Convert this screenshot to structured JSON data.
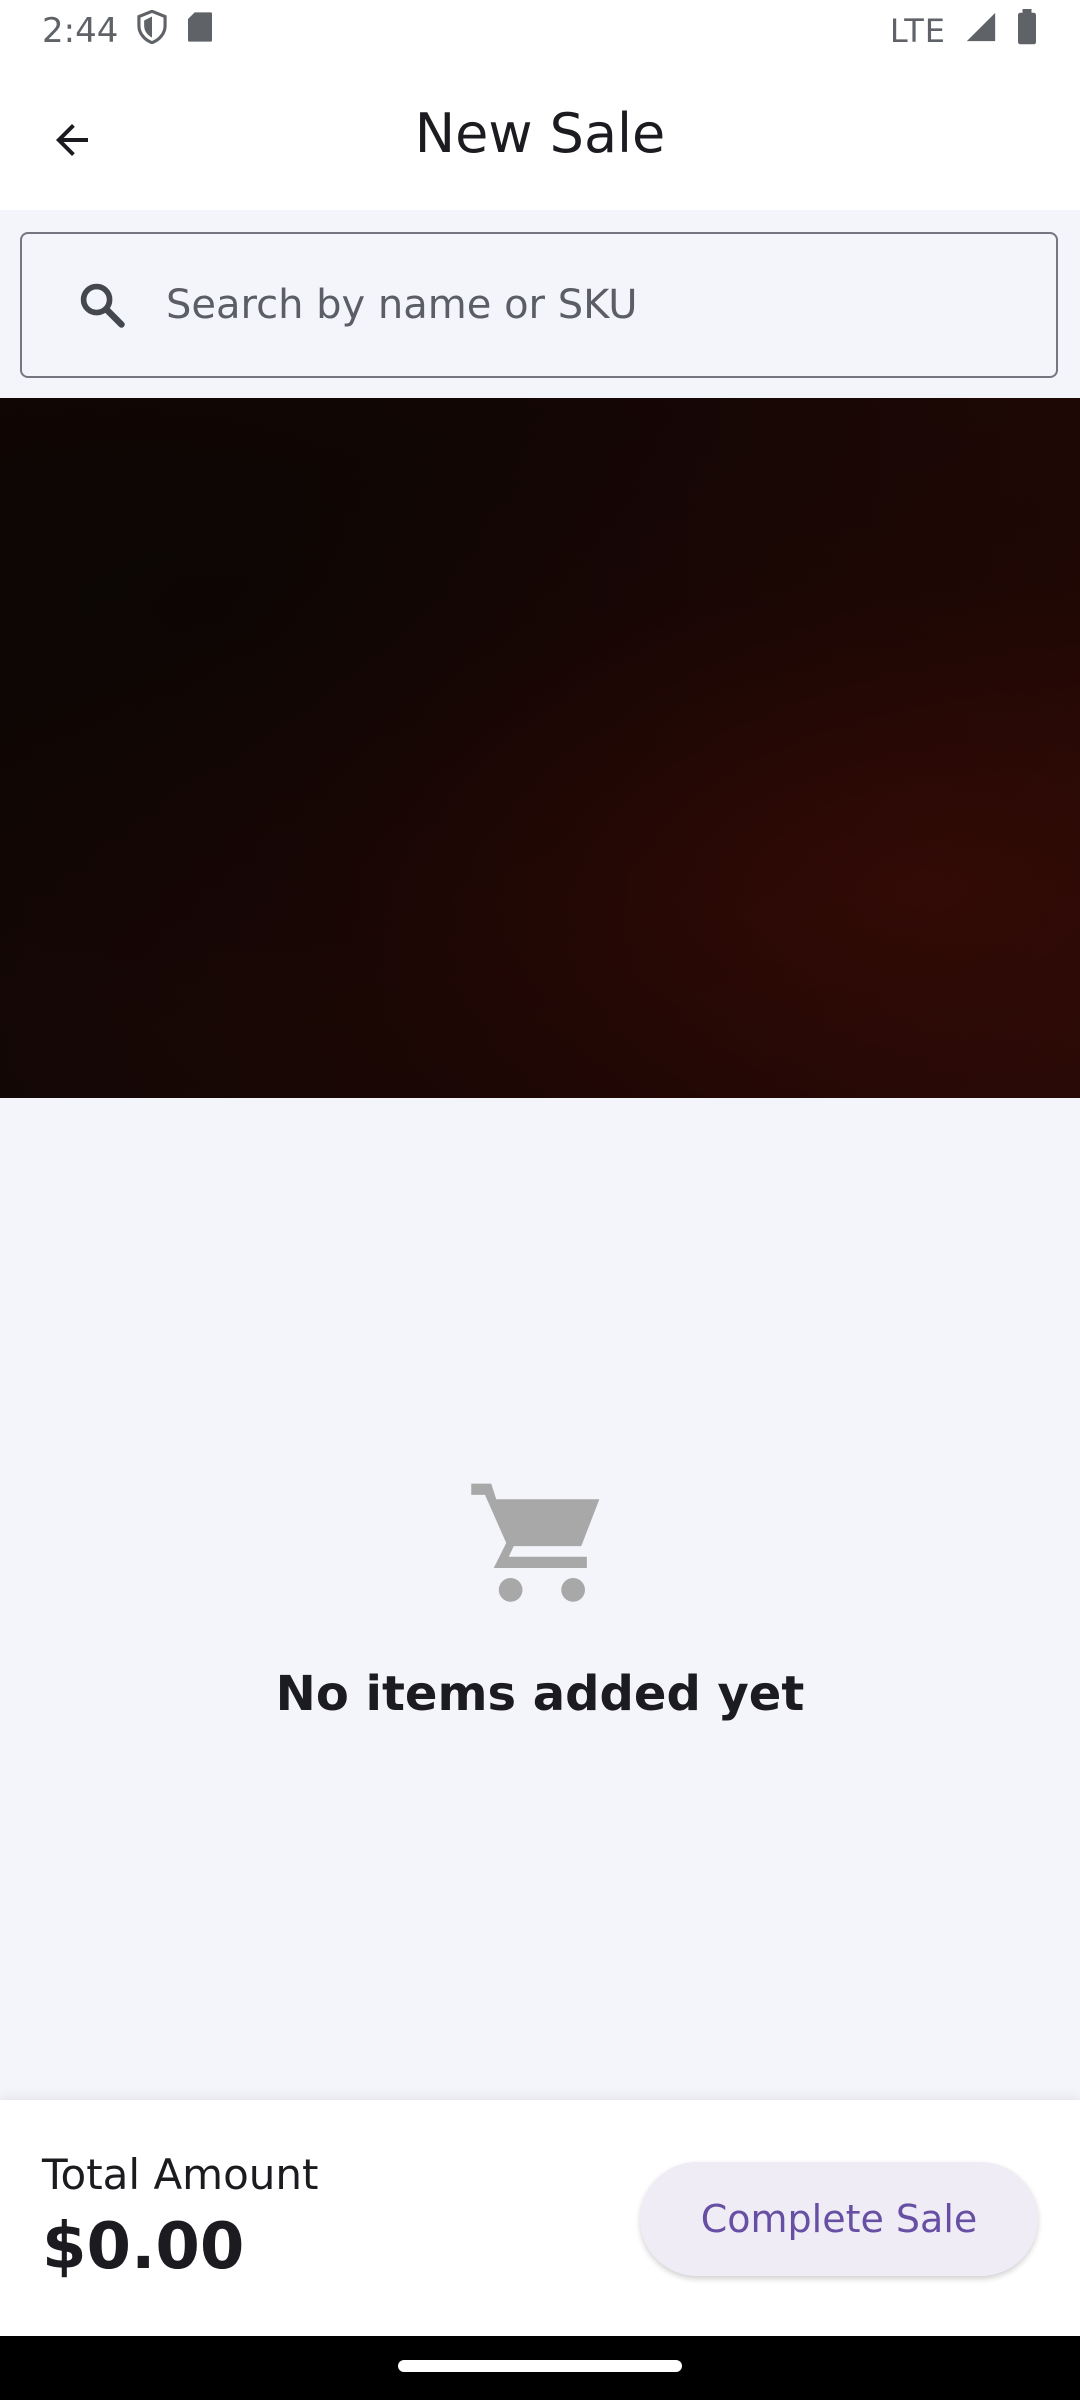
{
  "status_bar": {
    "time": "2:44",
    "network": "LTE",
    "icons": [
      "shield-icon",
      "sd-card-icon",
      "signal-icon",
      "battery-icon"
    ]
  },
  "app_bar": {
    "title": "New Sale",
    "back_icon": "arrow-back-icon"
  },
  "search": {
    "placeholder": "Search by name or SKU",
    "value": "",
    "icon": "search-icon"
  },
  "camera_preview": {
    "state": "dark"
  },
  "empty_state": {
    "icon": "shopping-cart-icon",
    "message": "No items added yet"
  },
  "footer": {
    "total_label": "Total Amount",
    "total_value": "$0.00",
    "complete_button_label": "Complete Sale"
  },
  "colors": {
    "accent": "#6750a4",
    "button_bg": "#f0ecf6",
    "surface": "#f4f5fa",
    "icon_muted": "#a8a8a8"
  }
}
